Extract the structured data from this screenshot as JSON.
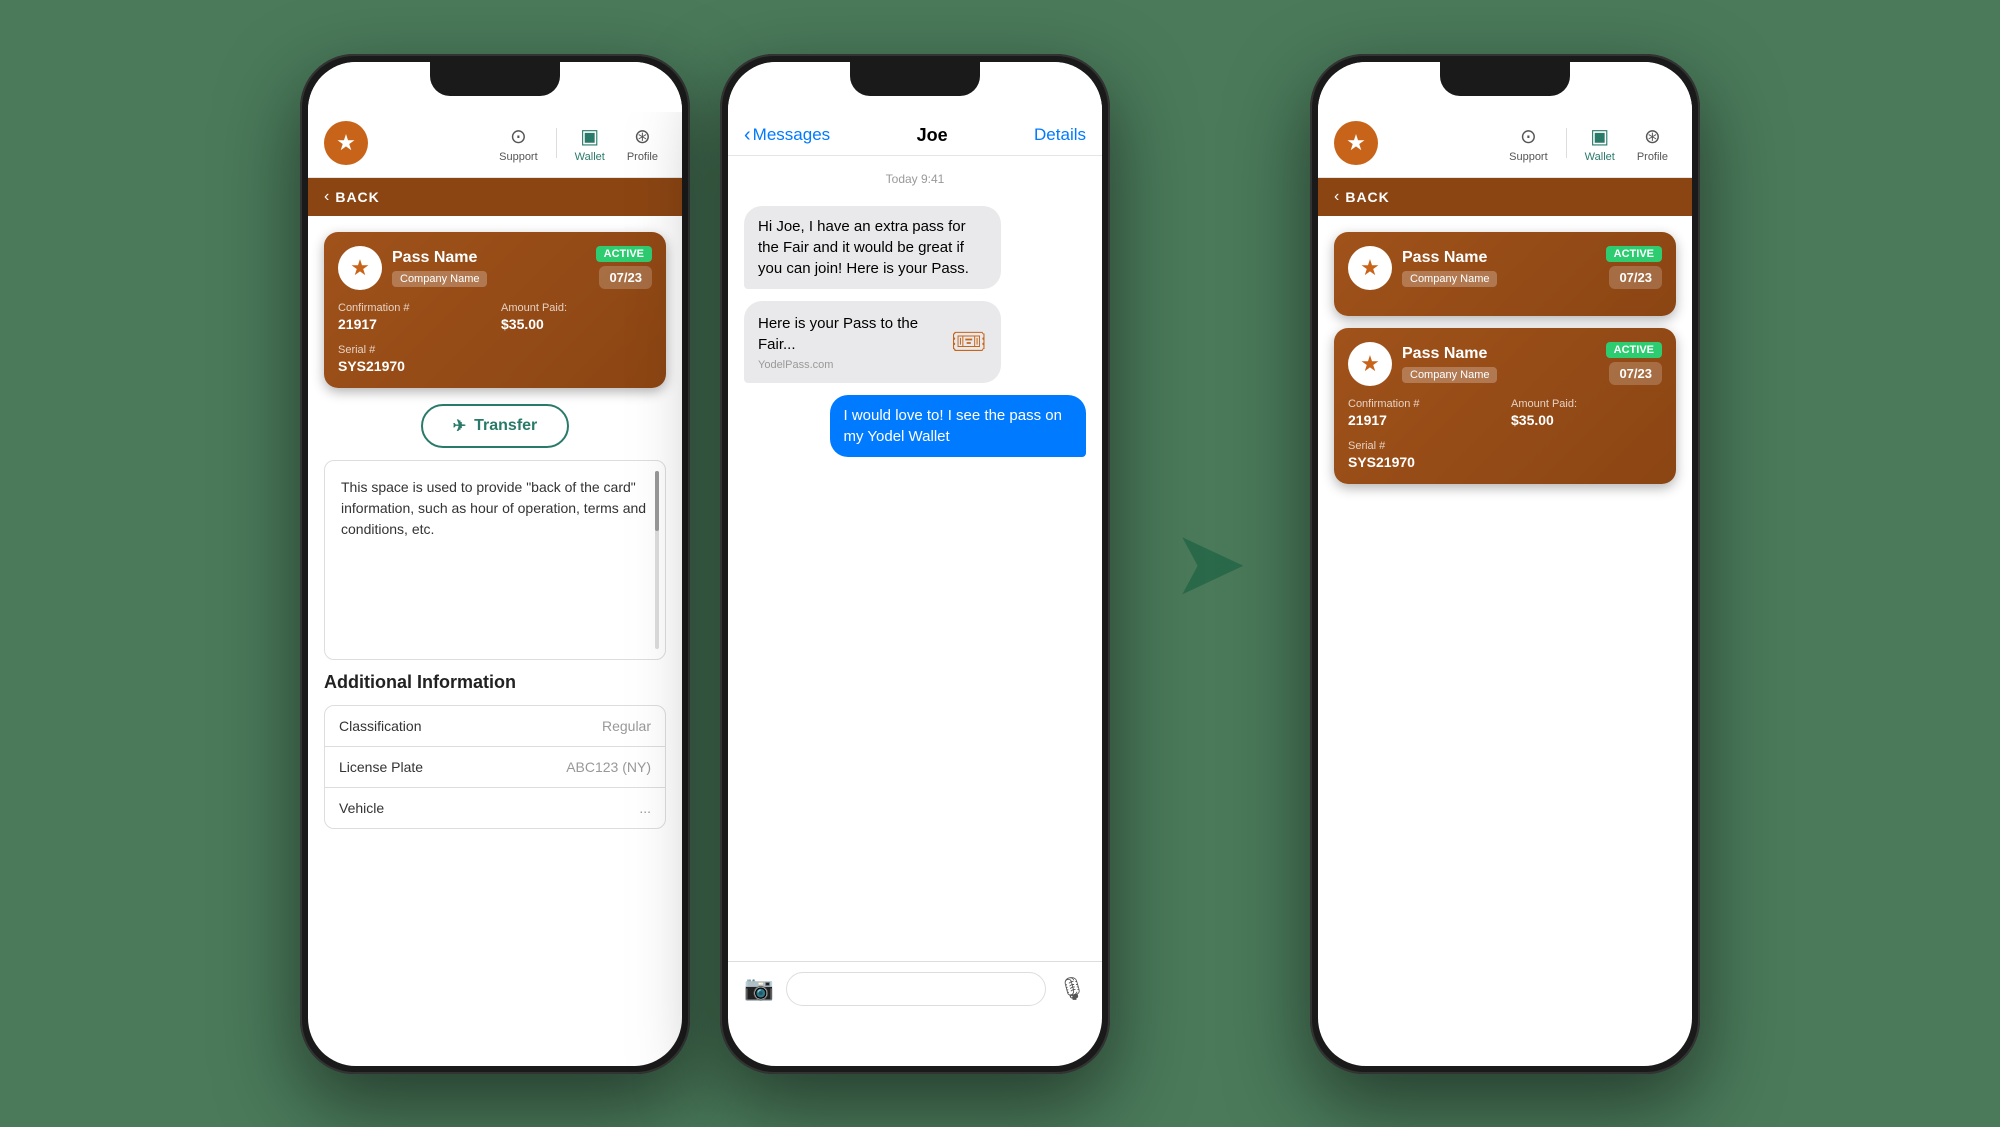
{
  "phone1": {
    "nav": {
      "support_label": "Support",
      "wallet_label": "Wallet",
      "profile_label": "Profile"
    },
    "back_label": "BACK",
    "pass": {
      "name": "Pass Name",
      "company": "Company Name",
      "active_label": "ACTIVE",
      "date": "07/23",
      "confirmation_label": "Confirmation #",
      "confirmation_value": "21917",
      "amount_label": "Amount Paid:",
      "amount_value": "$35.00",
      "serial_label": "Serial #",
      "serial_value": "SYS21970"
    },
    "transfer_label": "Transfer",
    "info_text": "This space is used to provide \"back of the card\" information, such as hour of operation, terms and conditions, etc.",
    "additional_info_title": "Additional Information",
    "table_rows": [
      {
        "label": "Classification",
        "value": "Regular"
      },
      {
        "label": "License Plate",
        "value": "ABC123 (NY)"
      },
      {
        "label": "Vehicle",
        "value": "..."
      }
    ]
  },
  "phone2": {
    "messages_back": "Messages",
    "messages_title": "Joe",
    "messages_details": "Details",
    "timestamp": "Today 9:41",
    "messages": [
      {
        "type": "received",
        "text": "Hi Joe, I have an extra pass for the Fair and it would be great if you can join! Here is your Pass."
      },
      {
        "type": "pass-preview",
        "text": "Here is your Pass to the Fair...",
        "domain": "YodelPass.com"
      },
      {
        "type": "sent",
        "text": "I would love to! I see the pass on my Yodel Wallet"
      }
    ]
  },
  "phone3": {
    "nav": {
      "support_label": "Support",
      "wallet_label": "Wallet",
      "profile_label": "Profile"
    },
    "back_label": "BACK",
    "passes": [
      {
        "name": "Pass Name",
        "company": "Company Name",
        "active_label": "ACTIVE",
        "date": "07/23"
      },
      {
        "name": "Pass Name",
        "company": "Company Name",
        "active_label": "ACTIVE",
        "date": "07/23",
        "confirmation_label": "Confirmation #",
        "confirmation_value": "21917",
        "amount_label": "Amount Paid:",
        "amount_value": "$35.00",
        "serial_label": "Serial #",
        "serial_value": "SYS21970"
      }
    ]
  },
  "arrow": {
    "symbol": "➤"
  }
}
